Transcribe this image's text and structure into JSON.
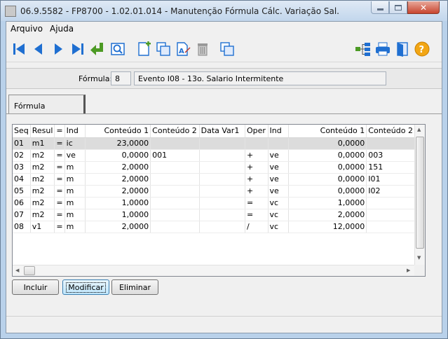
{
  "window": {
    "title": "06.9.5582 - FP8700 - 1.02.01.014 - Manutenção Fórmula Cálc. Variação Sal."
  },
  "menu": {
    "arquivo_label": "Arquivo",
    "ajuda_label": "Ajuda"
  },
  "toolbar": {
    "icons": [
      "first-record-icon",
      "previous-record-icon",
      "next-record-icon",
      "last-record-icon",
      "return-icon",
      "search-icon",
      "new-document-icon",
      "copy-icon",
      "edit-text-icon",
      "delete-trash-icon",
      "duplicate-icon",
      "tree-structure-icon",
      "print-icon",
      "exit-door-icon",
      "help-icon"
    ]
  },
  "header": {
    "formula_label": "Fórmula:",
    "formula_number": "8",
    "formula_description": "Evento I08 - 13o. Salario Intermitente"
  },
  "tab": {
    "label": "Fórmula"
  },
  "grid": {
    "columns": [
      "Seq",
      "Resul",
      "=",
      "Ind",
      "Conteúdo 1",
      "Conteúdo 2",
      "Data Var1",
      "Oper",
      "Ind",
      "Conteúdo 1",
      "Conteúdo 2"
    ],
    "rows": [
      [
        "01",
        "m1",
        "=",
        "ic",
        "23,0000",
        "",
        "",
        "",
        "",
        "0,0000",
        ""
      ],
      [
        "02",
        "m2",
        "=",
        "ve",
        "0,0000",
        "001",
        "",
        "+",
        "ve",
        "0,0000",
        "003"
      ],
      [
        "03",
        "m2",
        "=",
        "m",
        "2,0000",
        "",
        "",
        "+",
        "ve",
        "0,0000",
        "151"
      ],
      [
        "04",
        "m2",
        "=",
        "m",
        "2,0000",
        "",
        "",
        "+",
        "ve",
        "0,0000",
        "I01"
      ],
      [
        "05",
        "m2",
        "=",
        "m",
        "2,0000",
        "",
        "",
        "+",
        "ve",
        "0,0000",
        "I02"
      ],
      [
        "06",
        "m2",
        "=",
        "m",
        "1,0000",
        "",
        "",
        "=",
        "vc",
        "1,0000",
        ""
      ],
      [
        "07",
        "m2",
        "=",
        "m",
        "1,0000",
        "",
        "",
        "=",
        "vc",
        "2,0000",
        ""
      ],
      [
        "08",
        "v1",
        "=",
        "m",
        "2,0000",
        "",
        "",
        "/",
        "vc",
        "12,0000",
        ""
      ]
    ],
    "selected_row_index": 0
  },
  "buttons": {
    "incluir_label": "Incluir",
    "modificar_label": "Modificar",
    "eliminar_label": "Eliminar"
  },
  "colors": {
    "toolbar_blue": "#1f6fd1",
    "return_green": "#4c9a24",
    "help_orange": "#f2a614",
    "selected_row": "#dcdcdc"
  }
}
